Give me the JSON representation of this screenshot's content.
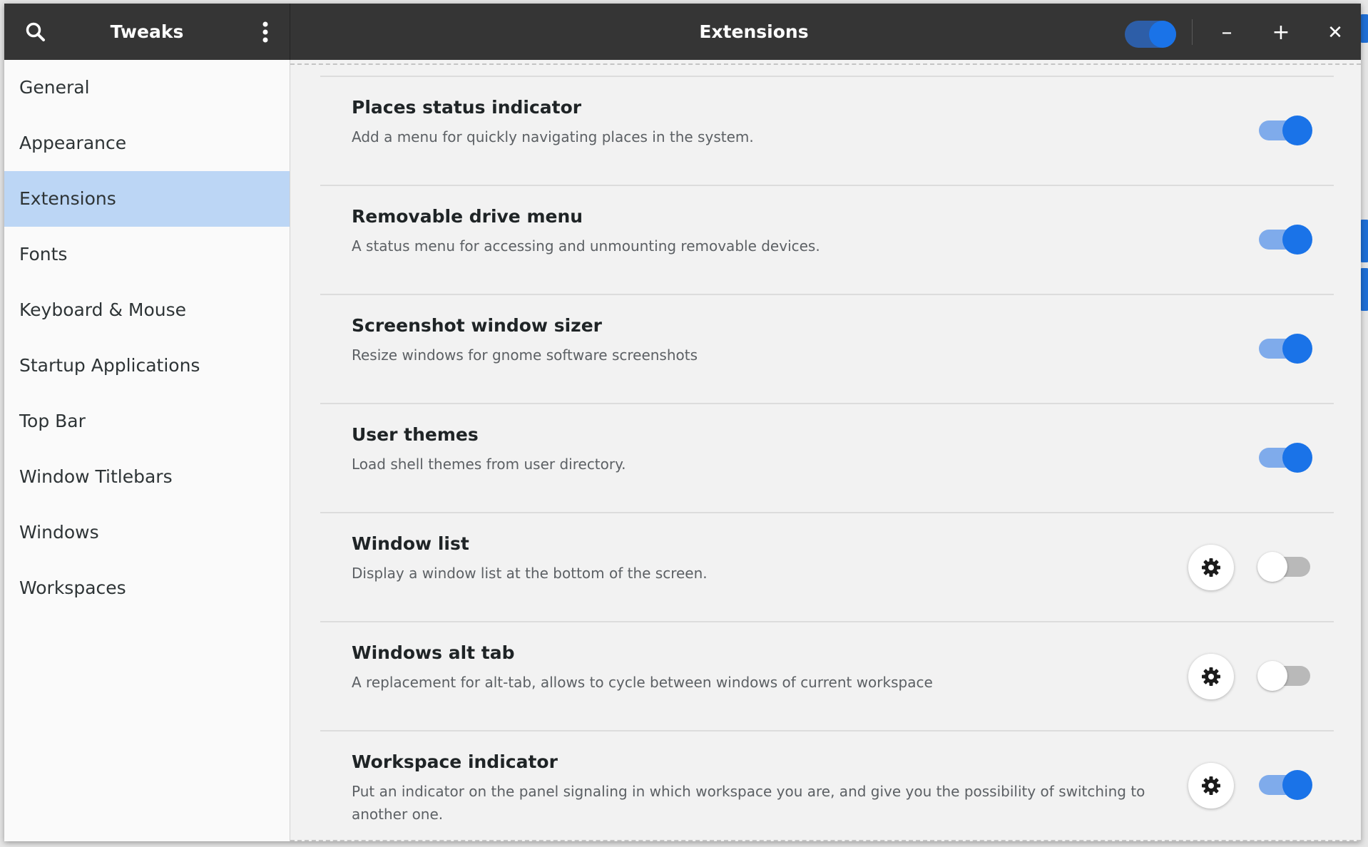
{
  "colors": {
    "headerbar": "#353535",
    "accent": "#1a73e8",
    "accent_track": "#7fabeb",
    "selected_row": "#bcd6f5",
    "sidebar_bg": "#fafafa",
    "content_bg": "#f2f2f2"
  },
  "header": {
    "left_title": "Tweaks",
    "title": "Extensions",
    "extensions_master_switch": "on",
    "search_icon": "search-icon",
    "menu_icon": "vertical-dots-icon",
    "minimize_label": "–",
    "maximize_label": "+",
    "close_label": "✕"
  },
  "sidebar": {
    "items": [
      {
        "label": "General",
        "selected": false
      },
      {
        "label": "Appearance",
        "selected": false
      },
      {
        "label": "Extensions",
        "selected": true
      },
      {
        "label": "Fonts",
        "selected": false
      },
      {
        "label": "Keyboard & Mouse",
        "selected": false
      },
      {
        "label": "Startup Applications",
        "selected": false
      },
      {
        "label": "Top Bar",
        "selected": false
      },
      {
        "label": "Window Titlebars",
        "selected": false
      },
      {
        "label": "Windows",
        "selected": false
      },
      {
        "label": "Workspaces",
        "selected": false
      }
    ]
  },
  "extensions": [
    {
      "name": "Places status indicator",
      "description": "Add a menu for quickly navigating places in the system.",
      "enabled": true,
      "has_settings": false
    },
    {
      "name": "Removable drive menu",
      "description": "A status menu for accessing and unmounting removable devices.",
      "enabled": true,
      "has_settings": false
    },
    {
      "name": "Screenshot window sizer",
      "description": "Resize windows for gnome software screenshots",
      "enabled": true,
      "has_settings": false
    },
    {
      "name": "User themes",
      "description": "Load shell themes from user directory.",
      "enabled": true,
      "has_settings": false
    },
    {
      "name": "Window list",
      "description": "Display a window list at the bottom of the screen.",
      "enabled": false,
      "has_settings": true
    },
    {
      "name": "Windows alt tab",
      "description": "A replacement for alt-tab, allows to cycle between windows of current workspace",
      "enabled": false,
      "has_settings": true
    },
    {
      "name": "Workspace indicator",
      "description": "Put an indicator on the panel signaling in which workspace you are, and give you the possibility of switching to another one.",
      "enabled": true,
      "has_settings": true
    }
  ]
}
